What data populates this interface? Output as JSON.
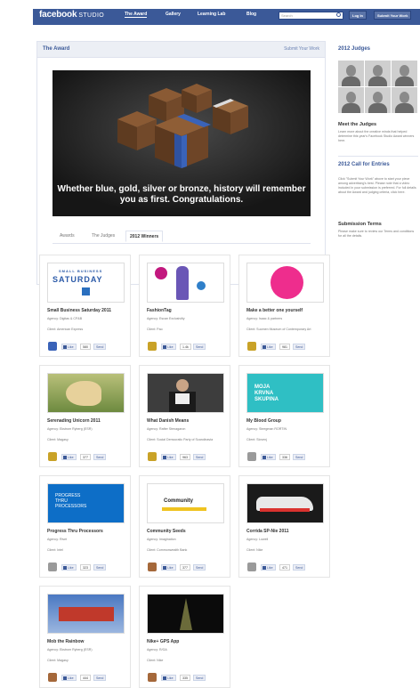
{
  "header": {
    "logo": "facebook",
    "logo_sub": "STUDIO",
    "nav": [
      "The Award",
      "Gallery",
      "Learning Lab",
      "Blog"
    ],
    "search_placeholder": "Search",
    "login": "Log In",
    "submit": "Submit Your Work"
  },
  "main": {
    "title": "The Award",
    "submit_link": "Submit Your Work",
    "hero_caption": "Whether blue, gold, silver or bronze, history will remember you as first. Congratulations.",
    "tabs": [
      "Awards",
      "The Judges",
      "2012 Winners"
    ]
  },
  "sidebar": {
    "judges_title": "2012 Judges",
    "meet_title": "Meet the Judges",
    "meet_text": "Learn more about the creative minds that helped determine this year's Facebook Studio Award winners here.",
    "call_title": "2012 Call for Entries",
    "call_text": "Click \"Submit Your Work\" above to start your piece among advertising's best. Please note that a video included in your submission is preferred. For full details about the Award and judging criteria, click here.",
    "terms_title": "Submission Terms",
    "terms_text": "Please make sure to review our Terms and conditions for all the details."
  },
  "cards": [
    {
      "title": "Small Business Saturday 2011",
      "agency": "Agency: Digitas & CP&B",
      "client": "Client: American Express",
      "likes": "580",
      "award": "blue"
    },
    {
      "title": "FashionTag",
      "agency": "Agency: Escan Exclusivitiy",
      "client": "Client: Pao",
      "likes": "1.4k",
      "award": "gold"
    },
    {
      "title": "Make a better one yourself",
      "agency": "Agency: Isaac & partners",
      "client": "Client: Suomen Museum of Contemporary Art",
      "likes": "981",
      "award": "gold"
    },
    {
      "title": "Serenading Unicorn 2011",
      "agency": "Agency: Ekstrom Ryberg (ESR)",
      "client": "Client: Magasy",
      "likes": "377",
      "award": "gold"
    },
    {
      "title": "What Danish Means",
      "agency": "Agency: Rafter Stenagaron",
      "client": "Client: Social Democratic Party of Scandinavia",
      "likes": "963",
      "award": "gold"
    },
    {
      "title": "My Blood Group",
      "agency": "Agency: Steegman RORTIN",
      "client": "Client: Slovenj",
      "likes": "336",
      "award": "silver"
    },
    {
      "title": "Progress Thru Processors",
      "agency": "Agency: Rivet",
      "client": "Client: Intel",
      "likes": "323",
      "award": "silver"
    },
    {
      "title": "Community Seeds",
      "agency": "Agency: Imagination",
      "client": "Client: Commonwealth Bank",
      "likes": "377",
      "award": "bronze"
    },
    {
      "title": "Corrida SP-Nie 2011",
      "agency": "Agency: Lowell",
      "client": "Client: Nike",
      "likes": "471",
      "award": "silver"
    },
    {
      "title": "Mob the Rainbow",
      "agency": "Agency: Ekstrom Ryberg (ESR)",
      "client": "Client: Magasy",
      "likes": "444",
      "award": "bronze"
    },
    {
      "title": "Nike+ GPS App",
      "agency": "Agency: R/GA",
      "client": "Client: Nike",
      "likes": "335",
      "award": "bronze"
    }
  ],
  "buttons": {
    "like": "Like",
    "send": "Send"
  },
  "colors": {
    "facebook_blue": "#3b5998",
    "gold": "#c9a227",
    "silver": "#9a9a9a",
    "bronze": "#a5683a",
    "blue": "#3a63b8"
  }
}
